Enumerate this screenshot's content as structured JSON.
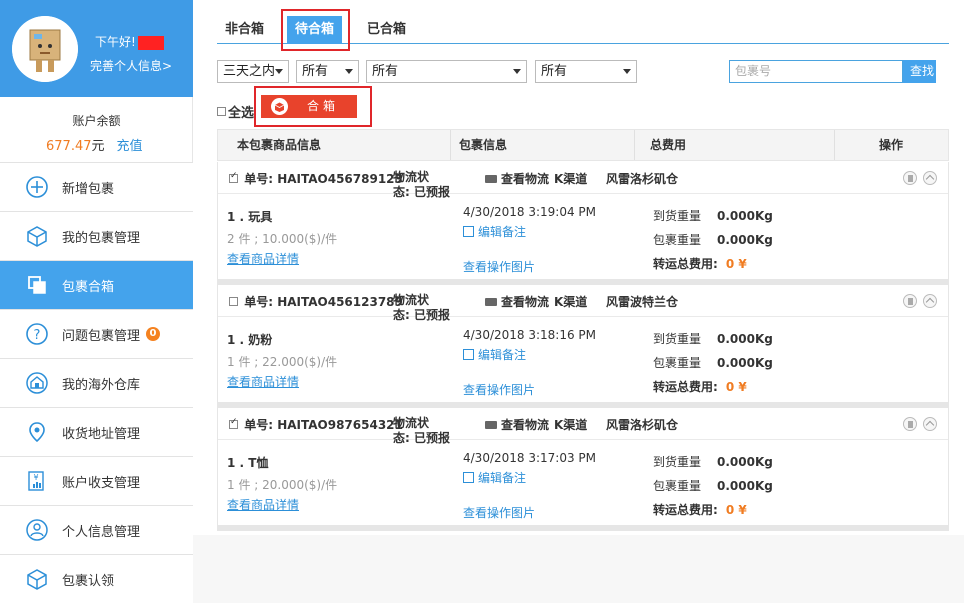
{
  "sidebar": {
    "greeting": "下午好!",
    "complete_profile": "完善个人信息>",
    "balance_label": "账户余额",
    "balance_amount": "677.47",
    "balance_unit": "元",
    "recharge": "充值",
    "items": [
      {
        "label": "新增包裹",
        "icon": "plus-circle-icon",
        "active": false
      },
      {
        "label": "我的包裹管理",
        "icon": "package-icon",
        "active": false
      },
      {
        "label": "包裹合箱",
        "icon": "merge-boxes-icon",
        "active": true
      },
      {
        "label": "问题包裹管理",
        "icon": "question-icon",
        "active": false,
        "badge": "0"
      },
      {
        "label": "我的海外仓库",
        "icon": "warehouse-icon",
        "active": false
      },
      {
        "label": "收货地址管理",
        "icon": "location-pin-icon",
        "active": false
      },
      {
        "label": "账户收支管理",
        "icon": "finance-icon",
        "active": false
      },
      {
        "label": "个人信息管理",
        "icon": "user-icon",
        "active": false
      },
      {
        "label": "包裹认领",
        "icon": "claim-package-icon",
        "active": false
      }
    ]
  },
  "tabs": [
    {
      "label": "非合箱"
    },
    {
      "label": "待合箱"
    },
    {
      "label": "已合箱"
    }
  ],
  "filters": {
    "time": "三天之内",
    "filter2": "所有",
    "filter3": "所有",
    "filter4": "所有",
    "search_placeholder": "包裹号",
    "search_button": "查找"
  },
  "select_all": "全选",
  "merge_button": "合箱",
  "table_headers": {
    "goods": "本包裹商品信息",
    "package": "包裹信息",
    "total": "总费用",
    "ops": "操作"
  },
  "labels": {
    "order_prefix": "单号:",
    "status_prefix": "物流状态:",
    "track": "查看物流",
    "qty_unit": "件",
    "detail": "查看商品详情",
    "edit_note": "编辑备注",
    "view_photos": "查看操作图片",
    "arrival_weight": "到货重量",
    "package_weight": "包裹重量",
    "total_fee": "转运总费用:",
    "currency": "¥"
  },
  "packages": [
    {
      "checked": true,
      "order": "HAITAO456789123",
      "status": "已预报",
      "channel": "K渠道",
      "warehouse": "风雷洛杉矶仓",
      "item": "1 . 玩具",
      "qty": "2 件 ; 10.000($)/件",
      "time": "4/30/2018 3:19:04 PM",
      "arrival_weight": "0.000Kg",
      "package_weight": "0.000Kg",
      "fee": "0"
    },
    {
      "checked": false,
      "order": "HAITAO456123789",
      "status": "已预报",
      "channel": "K渠道",
      "warehouse": "风雷波特兰仓",
      "item": "1 . 奶粉",
      "qty": "1 件 ; 22.000($)/件",
      "time": "4/30/2018 3:18:16 PM",
      "arrival_weight": "0.000Kg",
      "package_weight": "0.000Kg",
      "fee": "0"
    },
    {
      "checked": true,
      "order": "HAITAO987654321",
      "status": "已预报",
      "channel": "K渠道",
      "warehouse": "风雷洛杉矶仓",
      "item": "1 . T恤",
      "qty": "1 件 ; 20.000($)/件",
      "time": "4/30/2018 3:17:03 PM",
      "arrival_weight": "0.000Kg",
      "package_weight": "0.000Kg",
      "fee": "0"
    }
  ]
}
